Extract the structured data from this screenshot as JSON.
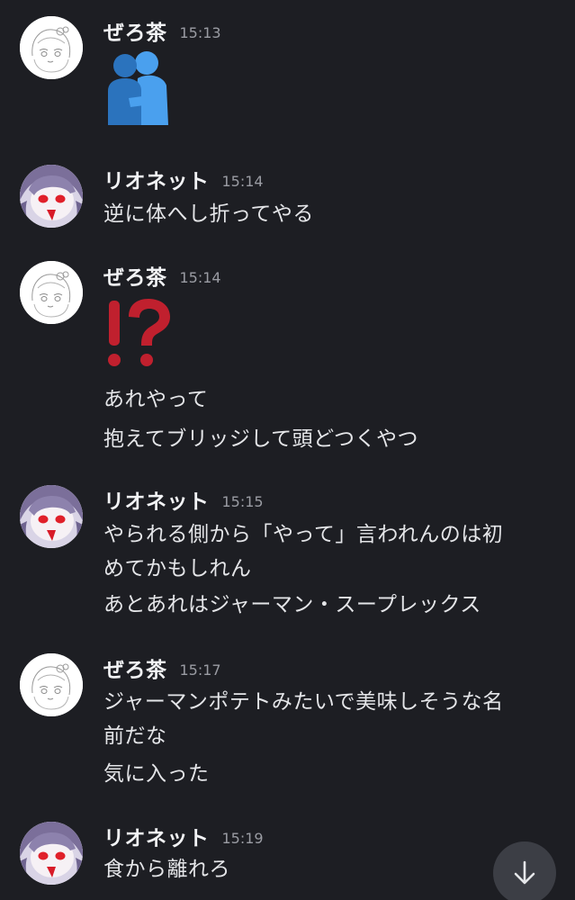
{
  "messages": [
    {
      "author": "ぜろ茶",
      "time": "15:13",
      "emoji": "people-hugging-emoji",
      "lines": []
    },
    {
      "author": "リオネット",
      "time": "15:14",
      "lines": [
        "逆に体へし折ってやる"
      ]
    },
    {
      "author": "ぜろ茶",
      "time": "15:14",
      "emoji": "exclamation-question-emoji",
      "lines": [
        "あれやって",
        "抱えてブリッジして頭どつくやつ"
      ]
    },
    {
      "author": "リオネット",
      "time": "15:15",
      "lines": [
        "やられる側から「やって」言われんのは初",
        "めてかもしれん",
        "あとあれはジャーマン・スープレックス"
      ]
    },
    {
      "author": "ぜろ茶",
      "time": "15:17",
      "lines": [
        "ジャーマンポテトみたいで美味しそうな名",
        "前だな",
        "気に入った"
      ]
    },
    {
      "author": "リオネット",
      "time": "15:19",
      "lines": [
        "食から離れろ"
      ]
    }
  ],
  "scroll_button": {
    "icon": "arrow-down-icon"
  },
  "colors": {
    "background": "#1d1e23",
    "text": "#e4e5e8",
    "timestamp": "#9a9ca3",
    "hug_emoji": "#3f8ee0",
    "interrobang": "#c0202e"
  }
}
